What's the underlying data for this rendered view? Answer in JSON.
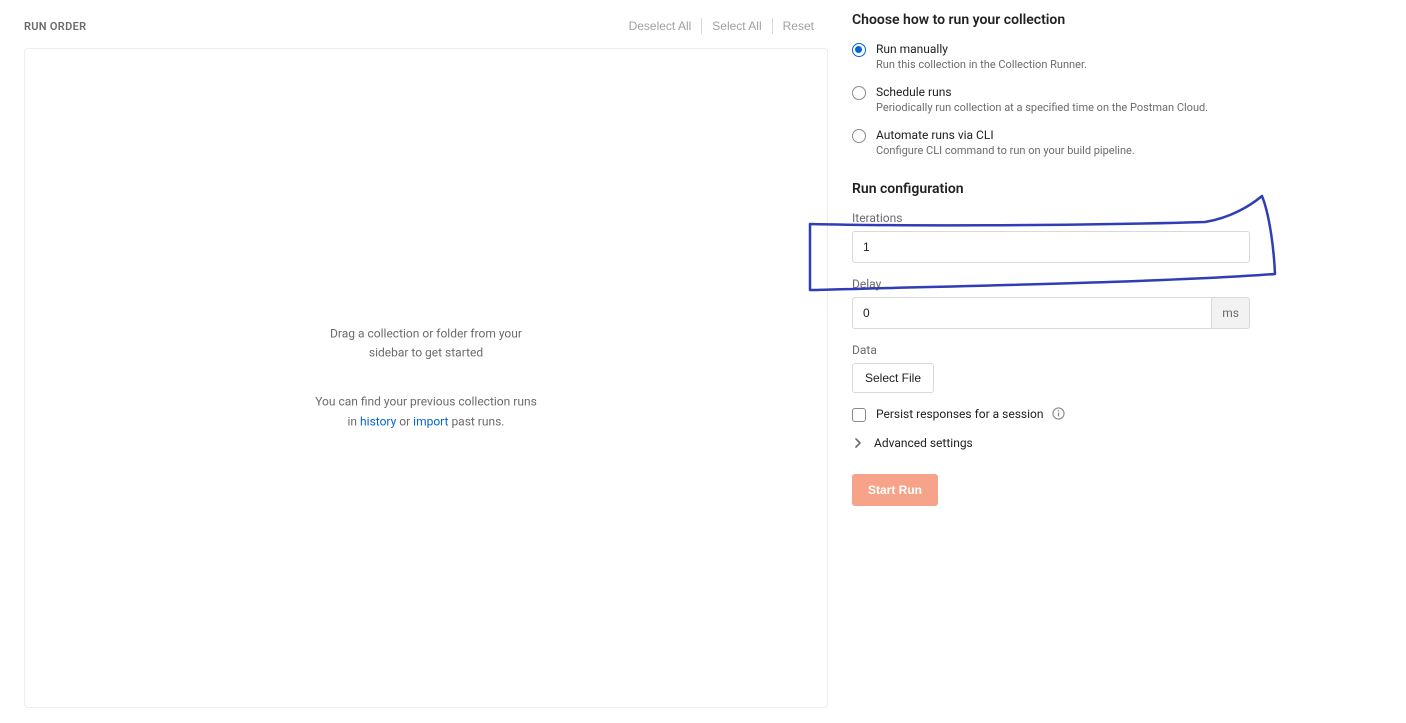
{
  "left": {
    "title": "RUN ORDER",
    "deselect": "Deselect All",
    "select": "Select All",
    "reset": "Reset",
    "drag_line1": "Drag a collection or folder from your",
    "drag_line2": "sidebar to get started",
    "prev_pre": "You can find your previous collection runs",
    "prev_in": "in ",
    "history_link": "history",
    "or": " or ",
    "import_link": "import",
    "past_runs": " past runs."
  },
  "right": {
    "choose_title": "Choose how to run your collection",
    "options": [
      {
        "label": "Run manually",
        "desc": "Run this collection in the Collection Runner.",
        "checked": true
      },
      {
        "label": "Schedule runs",
        "desc": "Periodically run collection at a specified time on the Postman Cloud.",
        "checked": false
      },
      {
        "label": "Automate runs via CLI",
        "desc": "Configure CLI command to run on your build pipeline.",
        "checked": false
      }
    ],
    "config_title": "Run configuration",
    "iterations_label": "Iterations",
    "iterations_value": "1",
    "delay_label": "Delay",
    "delay_value": "0",
    "delay_suffix": "ms",
    "data_label": "Data",
    "select_file": "Select File",
    "persist_label": "Persist responses for a session",
    "advanced": "Advanced settings",
    "start": "Start Run"
  }
}
